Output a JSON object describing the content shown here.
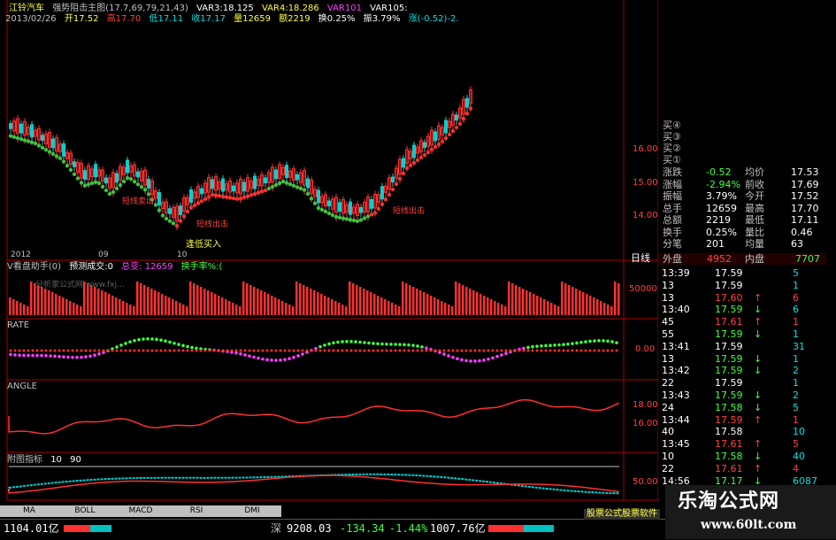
{
  "header": {
    "stock_name": "江铃汽车",
    "indicator_title": "强势阻击主图(17.7,69,79,21,43)",
    "var3": "VAR3:18.125",
    "var4": "VAR4:18.286",
    "var10": "VAR101",
    "var105": "VAR105:"
  },
  "quote_line": {
    "date": "2013/02/26",
    "open": "开17.52",
    "high": "高17.70",
    "low": "低17.11",
    "close": "收17.17",
    "vol": "量12659",
    "amount": "额2219",
    "turnover": "换0.25%",
    "amplitude": "振3.79%",
    "change": "涨(-0.52)-2."
  },
  "main_chart": {
    "y_ticks": [
      "16.00",
      "15.00",
      "14.00"
    ],
    "x_labels": [
      "2012",
      "09",
      "10"
    ],
    "annotations": [
      "短线卖出",
      "短线出击",
      "短线出击",
      "逢低买入"
    ],
    "colors": {
      "up": "#ff3030",
      "down": "#00d0d0",
      "dot_green": "#40c040",
      "dot_red": "#ff3030"
    }
  },
  "volume_panel": {
    "title": "V看盘助手(0)",
    "predict": "预测成交:0",
    "total_label": "总变:",
    "total_value": "12659",
    "turnover_label": "换手率%:(",
    "y_tick": "50000",
    "watermark": "分析家公式网 www.fxj..."
  },
  "rate_panel": {
    "title": "RATE",
    "y_tick": "0.00"
  },
  "angle_panel": {
    "title": "ANGLE",
    "y_ticks": [
      "18.00",
      "16.00"
    ]
  },
  "sub_panel": {
    "title": "附图指标",
    "params": "10",
    "params2": "90",
    "y_tick": "50.00"
  },
  "tabs": [
    "MA",
    "BOLL",
    "MACD",
    "RSI",
    "DMI"
  ],
  "status_bar": {
    "sh_value": "1104.01亿",
    "sz_label": "深",
    "sz_index": "9208.03",
    "sz_change": "-134.34",
    "sz_pct": "-1.44%",
    "sz_amount": "1007.76亿",
    "ad_text": "股票公式股票软件"
  },
  "brand": {
    "cn": "乐淘公式网",
    "url": "www.60lt.com"
  },
  "right_panel": {
    "bid_labels": [
      "买④",
      "买③",
      "买②",
      "买①"
    ],
    "stats": [
      {
        "l1": "涨跌",
        "v1": "-0.52",
        "l2": "均价",
        "v2": "17.53"
      },
      {
        "l1": "涨幅",
        "v1": "-2.94%",
        "l2": "前收",
        "v2": "17.69"
      },
      {
        "l1": "振幅",
        "v1": "3.79%",
        "l2": "今开",
        "v2": "17.52"
      },
      {
        "l1": "总手",
        "v1": "12659",
        "l2": "最高",
        "v2": "17.70"
      },
      {
        "l1": "总额",
        "v1": "2219",
        "l2": "最低",
        "v2": "17.11"
      },
      {
        "l1": "换手",
        "v1": "0.25%",
        "l2": "量比",
        "v2": "0.46"
      },
      {
        "l1": "分笔",
        "v1": "201",
        "l2": "均量",
        "v2": "63"
      }
    ],
    "outer": {
      "label": "外盘",
      "value": "4952",
      "label2": "内盘",
      "value2": "7707"
    },
    "daily_tag": "日线",
    "ticks": [
      {
        "time": "13:39",
        "price": "17.59",
        "arrow": "",
        "vol": "5"
      },
      {
        "time": "13",
        "price": "17.59",
        "arrow": "",
        "vol": "1"
      },
      {
        "time": "13",
        "price": "17.60",
        "arrow": "↑",
        "vol": "6"
      },
      {
        "time": "13:40",
        "price": "17.59",
        "arrow": "↓",
        "vol": "6"
      },
      {
        "time": "45",
        "price": "17.61",
        "arrow": "↑",
        "vol": "1"
      },
      {
        "time": "55",
        "price": "17.59",
        "arrow": "↓",
        "vol": "1"
      },
      {
        "time": "13:41",
        "price": "17.59",
        "arrow": "",
        "vol": "31"
      },
      {
        "time": "13",
        "price": "17.59",
        "arrow": "↓",
        "vol": "1"
      },
      {
        "time": "13:42",
        "price": "17.59",
        "arrow": "↓",
        "vol": "2"
      },
      {
        "time": "22",
        "price": "17.59",
        "arrow": "",
        "vol": "1"
      },
      {
        "time": "13:43",
        "price": "17.59",
        "arrow": "↓",
        "vol": "2"
      },
      {
        "time": "24",
        "price": "17.58",
        "arrow": "↓",
        "vol": "5"
      },
      {
        "time": "13:44",
        "price": "17.59",
        "arrow": "↑",
        "vol": "1"
      },
      {
        "time": "40",
        "price": "17.58",
        "arrow": "",
        "vol": "10"
      },
      {
        "time": "13:45",
        "price": "17.61",
        "arrow": "↑",
        "vol": "5"
      },
      {
        "time": "10",
        "price": "17.58",
        "arrow": "↓",
        "vol": "40"
      },
      {
        "time": "22",
        "price": "17.61",
        "arrow": "↑",
        "vol": "4"
      },
      {
        "time": "14:56",
        "price": "17.17",
        "arrow": "↓",
        "vol": "6087"
      }
    ]
  }
}
